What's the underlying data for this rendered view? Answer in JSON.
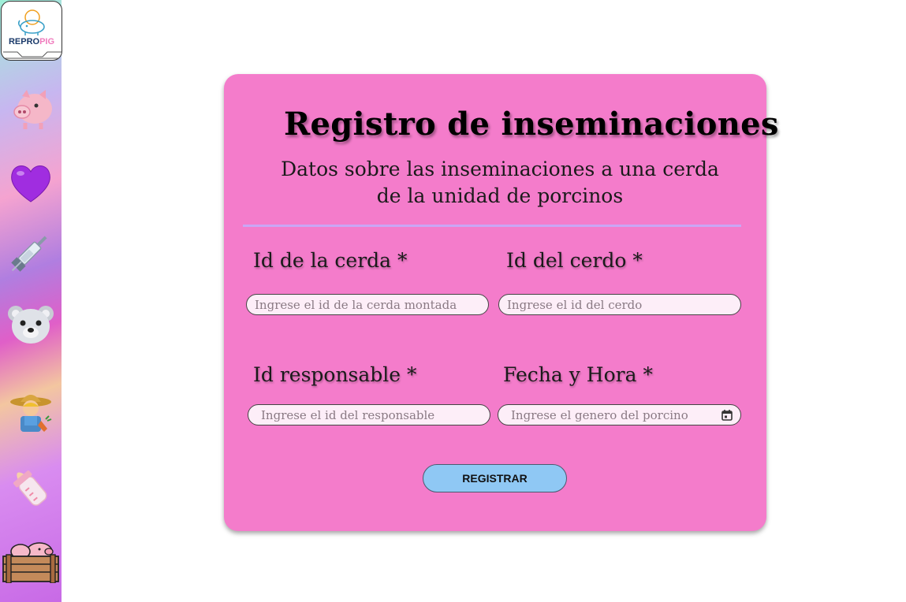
{
  "sidebar": {
    "logo_text_a": "REPRO",
    "logo_text_b": "PIG",
    "items": [
      {
        "icon": "pig-face-icon"
      },
      {
        "icon": "purple-heart-icon"
      },
      {
        "icon": "syringe-icon"
      },
      {
        "icon": "bear-face-icon"
      },
      {
        "icon": "farmer-icon"
      },
      {
        "icon": "baby-bottle-icon"
      },
      {
        "icon": "pig-pen-icon"
      }
    ]
  },
  "form": {
    "title": "Registro de inseminaciones",
    "subtitle_line1": "Datos sobre las inseminaciones a una cerda",
    "subtitle_line2": "de la unidad de porcinos",
    "fields": {
      "cerda": {
        "label": "Id de la cerda *",
        "placeholder": "Ingrese el id de la cerda montada",
        "value": ""
      },
      "cerdo": {
        "label": "Id del cerdo *",
        "placeholder": "Ingrese el id del cerdo",
        "value": ""
      },
      "responsable": {
        "label": "Id responsable *",
        "placeholder": "Ingrese el id del responsable",
        "value": ""
      },
      "fecha": {
        "label": "Fecha y Hora *",
        "placeholder": "Ingrese el genero del porcino",
        "value": ""
      }
    },
    "submit_label": "REGISTRAR"
  },
  "colors": {
    "card_bg": "#f47ccb",
    "divider": "#c9a6f5",
    "button_bg": "#8fc8f4",
    "input_bg": "#fdeef8"
  }
}
